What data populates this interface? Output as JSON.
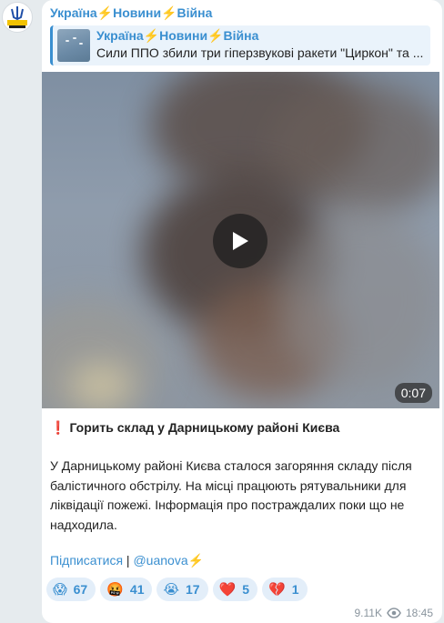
{
  "channel": {
    "name": "Україна⚡️Новини⚡️Війна"
  },
  "reply": {
    "title": "Україна⚡️Новини⚡️Війна",
    "text": "Сили ППО збили три гіперзвукові ракети \"Циркон\" та ..."
  },
  "video": {
    "duration": "0:07",
    "play_icon": "play-icon"
  },
  "post": {
    "headline_mark": "❗️",
    "headline": "Горить склад у Дарницькому районі Києва",
    "body": "У Дарницькому районі Києва сталося загоряння складу після балістичного обстрілу. На місці працюють рятувальники для ліквідації пожежі. Інформація про постраждалих поки що не надходила.",
    "subscribe_link": "Підписатися",
    "separator": " | ",
    "handle_link": "@uanova",
    "handle_emoji": "⚡️"
  },
  "reactions": [
    {
      "emoji": "😱",
      "count": "67"
    },
    {
      "emoji": "🤬",
      "count": "41"
    },
    {
      "emoji": "😭",
      "count": "17"
    },
    {
      "emoji": "❤️",
      "count": "5"
    },
    {
      "emoji": "💔",
      "count": "1"
    }
  ],
  "meta": {
    "views": "9.11K",
    "time": "18:45",
    "views_icon": "eye-icon"
  },
  "colors": {
    "accent": "#3a8fd0",
    "background": "#e6ebee",
    "bubble": "#ffffff",
    "reaction_bg": "#e3eef9"
  }
}
